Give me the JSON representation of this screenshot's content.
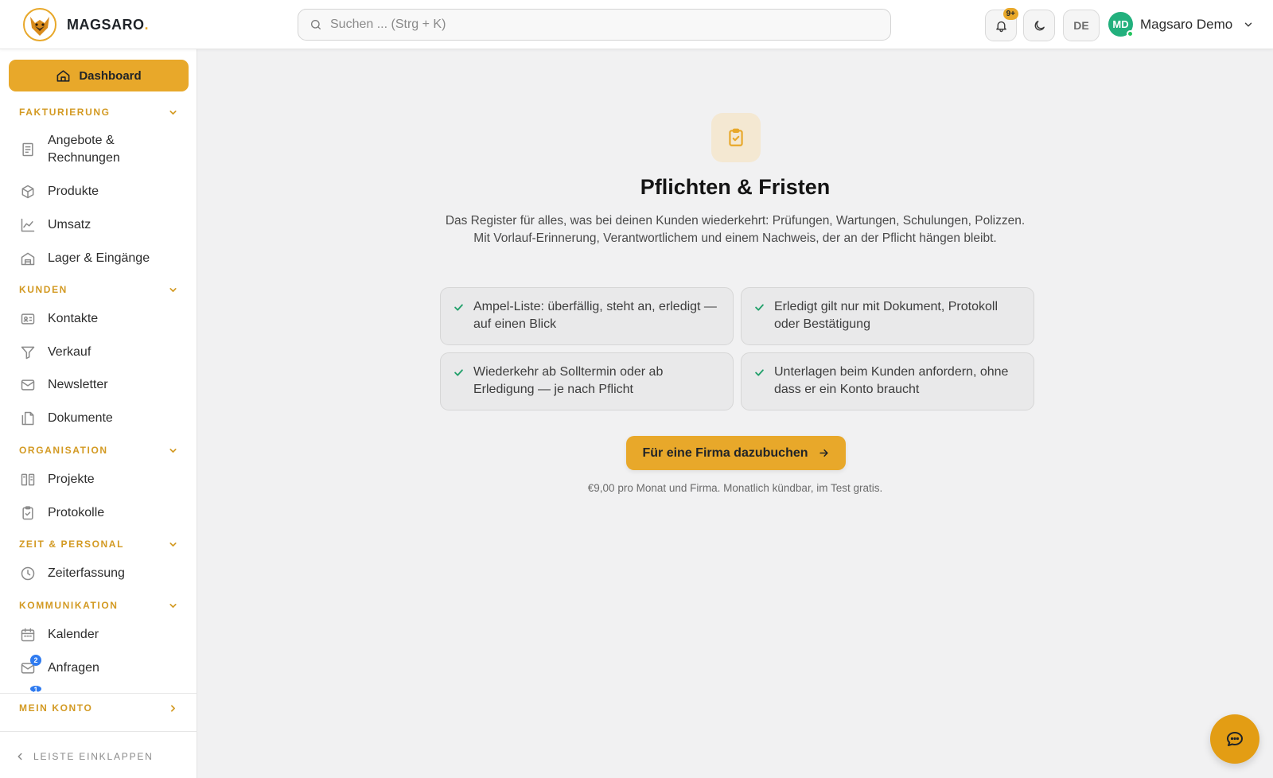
{
  "app": {
    "brand": "MAGSARO",
    "brand_dot": ".",
    "accent_color": "#e8a82a"
  },
  "header": {
    "search_placeholder": "Suchen ... (Strg + K)",
    "notifications_badge": "9+",
    "language": "DE",
    "user_initials": "MD",
    "user_name": "Magsaro Demo"
  },
  "sidebar": {
    "dashboard_label": "Dashboard",
    "sections": {
      "fakturierung": "FAKTURIERUNG",
      "kunden": "KUNDEN",
      "organisation": "ORGANISATION",
      "zeit": "ZEIT & PERSONAL",
      "kommunikation": "KOMMUNIKATION",
      "konto": "MEIN KONTO"
    },
    "items": {
      "angebote_line1": "Angebote &",
      "angebote_line2": "Rechnungen",
      "produkte": "Produkte",
      "umsatz": "Umsatz",
      "lager": "Lager & Eingänge",
      "kontakte": "Kontakte",
      "verkauf": "Verkauf",
      "newsletter": "Newsletter",
      "dokumente": "Dokumente",
      "projekte": "Projekte",
      "protokolle": "Protokolle",
      "zeiterfassung": "Zeiterfassung",
      "kalender": "Kalender",
      "anfragen": "Anfragen",
      "anfragen_badge": "2",
      "next_badge": "1"
    },
    "collapse_label": "LEISTE EINKLAPPEN"
  },
  "main": {
    "title": "Pflichten & Fristen",
    "description": "Das Register für alles, was bei deinen Kunden wiederkehrt: Prüfungen, Wartungen, Schulungen, Polizzen. Mit Vorlauf-Erinnerung, Verantwortlichem und einem Nachweis, der an der Pflicht hängen bleibt.",
    "features": [
      "Ampel-Liste: überfällig, steht an, erledigt — auf einen Blick",
      "Erledigt gilt nur mit Dokument, Protokoll oder Bestätigung",
      "Wiederkehr ab Solltermin oder ab Erledigung — je nach Pflicht",
      "Unterlagen beim Kunden anfordern, ohne dass er ein Konto braucht"
    ],
    "cta_label": "Für eine Firma dazubuchen",
    "price_note": "€9,00 pro Monat und Firma. Monatlich kündbar, im Test gratis."
  }
}
